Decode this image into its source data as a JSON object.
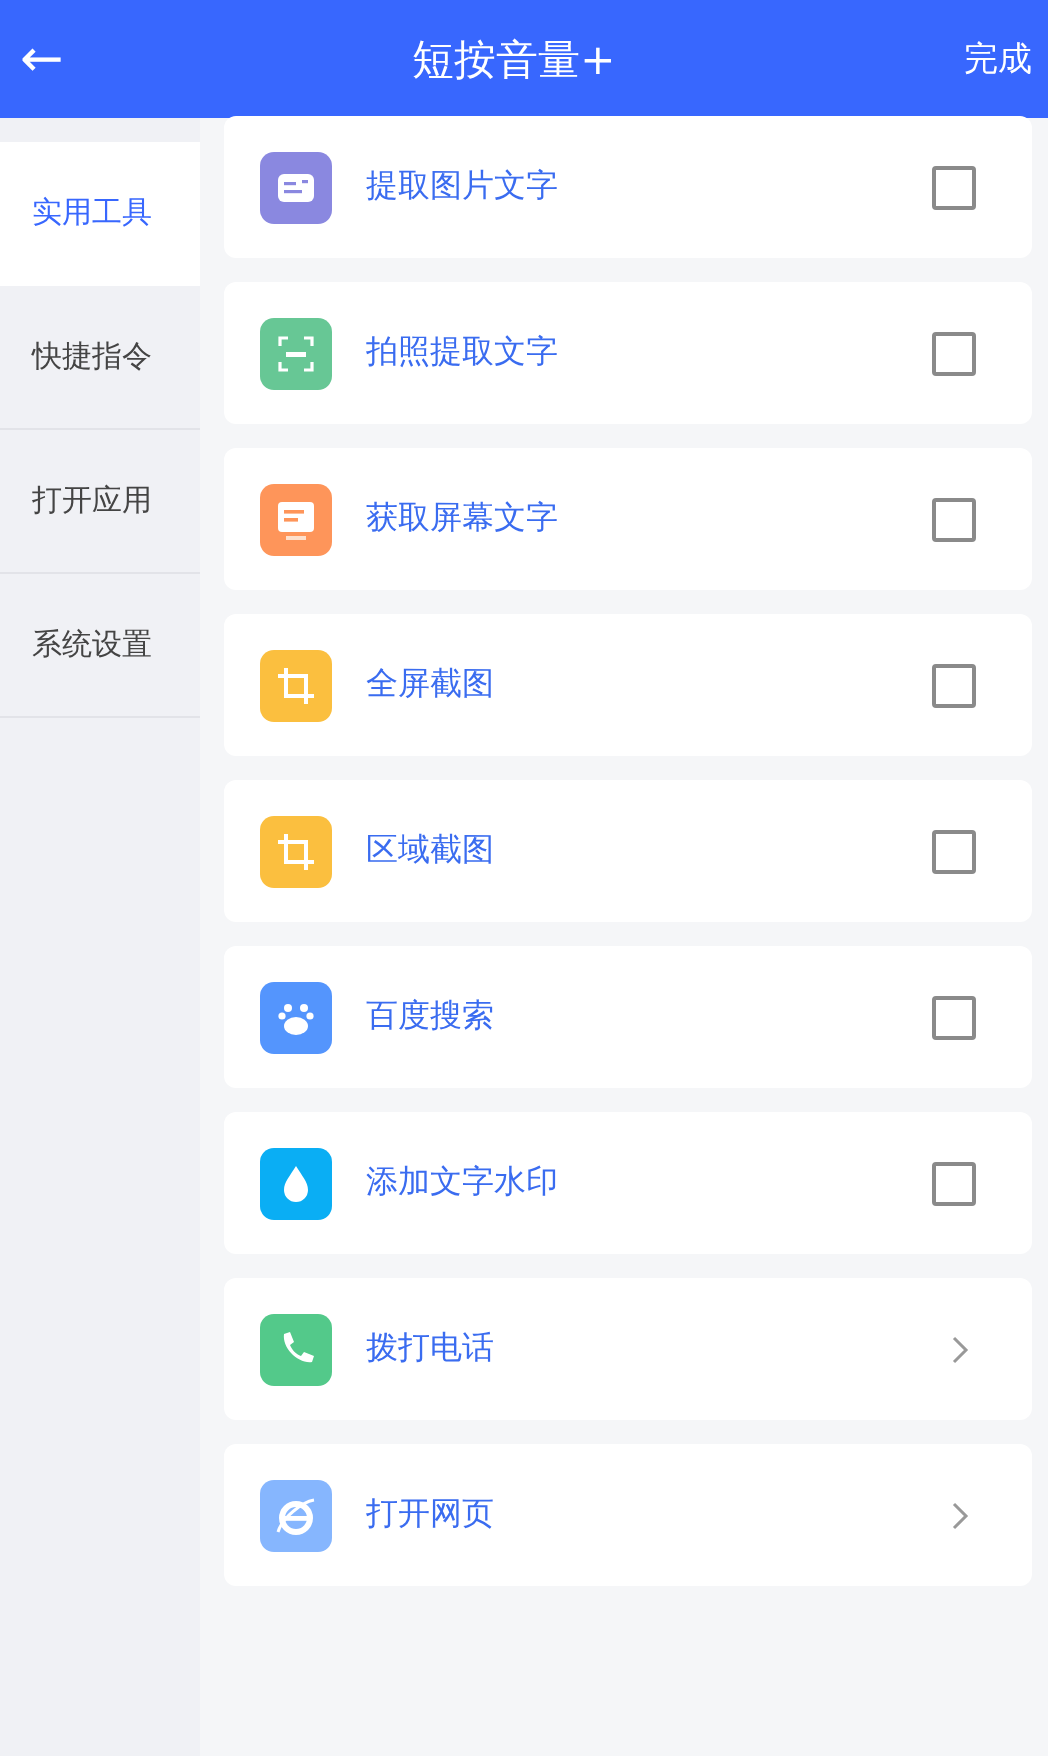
{
  "header": {
    "back": "←",
    "title": "短按音量+",
    "done": "完成"
  },
  "sidebar": {
    "items": [
      {
        "label": "实用工具",
        "selected": true
      },
      {
        "label": "快捷指令",
        "selected": false
      },
      {
        "label": "打开应用",
        "selected": false
      },
      {
        "label": "系统设置",
        "selected": false
      }
    ]
  },
  "actions": [
    {
      "label": "提取图片文字",
      "kind": "checkbox",
      "checked": false,
      "color": "#8a88e0"
    },
    {
      "label": "拍照提取文字",
      "kind": "checkbox",
      "checked": false,
      "color": "#67c795"
    },
    {
      "label": "获取屏幕文字",
      "kind": "checkbox",
      "checked": false,
      "color": "#fe955a"
    },
    {
      "label": "全屏截图",
      "kind": "checkbox",
      "checked": false,
      "color": "#fbbf3f"
    },
    {
      "label": "区域截图",
      "kind": "checkbox",
      "checked": false,
      "color": "#fbbf3f"
    },
    {
      "label": "百度搜索",
      "kind": "checkbox",
      "checked": false,
      "color": "#5495fd"
    },
    {
      "label": "添加文字水印",
      "kind": "checkbox",
      "checked": false,
      "color": "#0aaef4"
    },
    {
      "label": "拨打电话",
      "kind": "link",
      "color": "#53c98a"
    },
    {
      "label": "打开网页",
      "kind": "link",
      "color": "#86b6fe"
    }
  ]
}
